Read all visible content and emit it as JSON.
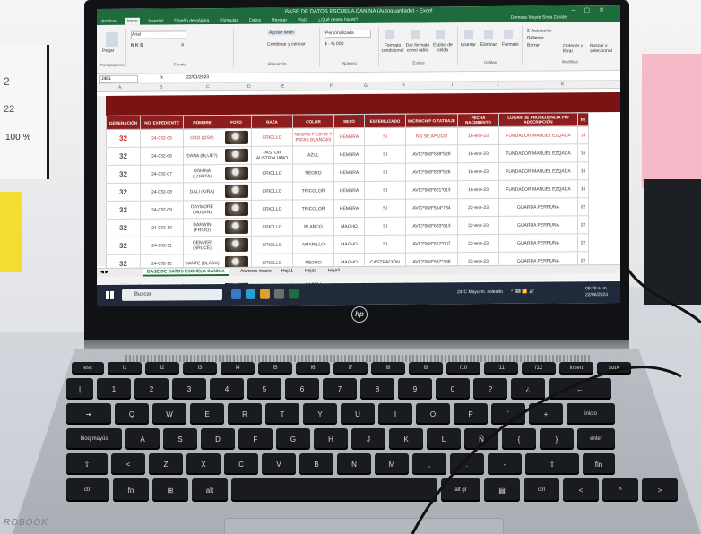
{
  "window": {
    "title": "BASE DE DATOS ESCUELA CANINA (Autoguardado) - Excel",
    "user": "Demaris Mayte Sosa Zarate",
    "share": "Compartir",
    "tabs": [
      "Archivo",
      "Inicio",
      "Insertar",
      "Diseño de página",
      "Fórmulas",
      "Datos",
      "Revisar",
      "Vista",
      "¿Qué desea hacer?"
    ]
  },
  "ribbon": {
    "paste": "Pegar",
    "clipboard": "Portapapeles",
    "font_name": "Arial",
    "font_group": "Fuente",
    "wrap": "Ajustar texto",
    "merge": "Combinar y centrar",
    "alignment_group": "Alineación",
    "number_format": "Personalizada",
    "number_group": "Número",
    "conditional": "Formato condicional",
    "as_table": "Dar formato como tabla",
    "cell_styles": "Estilos de celda",
    "styles_group": "Estilos",
    "insert": "Insertar",
    "delete": "Eliminar",
    "format": "Formato",
    "cells_group": "Celdas",
    "autosum": "Autosuma",
    "fill": "Rellenar",
    "clear": "Borrar",
    "sort": "Ordenar y filtrar",
    "find": "Buscar y seleccionar",
    "edit_group": "Modificar"
  },
  "formula_bar": {
    "ref": "J481",
    "fx": "fx",
    "value": "22/01/2023"
  },
  "columns": [
    "A",
    "B",
    "C",
    "D",
    "E",
    "F",
    "G",
    "H",
    "I",
    "J",
    "K"
  ],
  "table": {
    "headers": [
      "GENERACIÓN",
      "NO. EXPEDIENTE",
      "NOMBRE",
      "FOTO",
      "RAZA",
      "COLOR",
      "SEXO",
      "ESTERILIZADO",
      "MICROCHIP O TATUAJE",
      "FECHA NACIMIENTO",
      "LUGAR DE PROCEDENCIA PIO ADSCRIPCIÓN",
      "FE"
    ],
    "rows": [
      [
        "32",
        "24-032-05",
        "OSO (OSA)",
        "",
        "CRIOLLO",
        "NEGRO PECHO Y PATAS BLANCAS",
        "HEMBRA",
        "SI",
        "NO SE APLICO",
        "16-ene-23",
        "FUNDADOR MANUEL EZQADA",
        "15"
      ],
      [
        "32",
        "24-032-06",
        "DANA (BLUE?)",
        "",
        "PASTOR AUSTRALIANO",
        "AZUL",
        "HEMBRA",
        "SI",
        "AVID*068*538*529",
        "16-ene-23",
        "FUNDADOR MANUEL EZQADA",
        "16"
      ],
      [
        "32",
        "24-032-07",
        "OSHINA (LORITA)",
        "",
        "CRIOLLO",
        "NEGRO",
        "HEMBRA",
        "SI",
        "AVID*068*828*526",
        "16-ene-23",
        "FUNDADOR MANUEL EZQADA",
        "16"
      ],
      [
        "32",
        "24-032-08",
        "DALI (KIRA)",
        "",
        "CRIOLLO",
        "TRICOLOR",
        "HEMBRA",
        "SI",
        "AVID*068*621*013",
        "16-ene-23",
        "FUNDADOR MANUEL EZQADA",
        "16"
      ],
      [
        "32",
        "24-032-09",
        "DAYMORE (MULAN)",
        "",
        "CRIOLLO",
        "TRICOLOR",
        "HEMBRA",
        "SI",
        "AVID*068*514*784",
        "22-ene-23",
        "GUARDA PERRUNA",
        "22"
      ],
      [
        "32",
        "24-032-10",
        "DARWIN (FRIDO)",
        "",
        "CRIOLLO",
        "BLANCO",
        "MACHO",
        "SI",
        "AVID*068*620*613",
        "22-ene-23",
        "GUARDA PERRUNA",
        "22"
      ],
      [
        "32",
        "24-032-11",
        "DENVER (BRUCE)",
        "",
        "CRIOLLO",
        "AMARILLO",
        "MACHO",
        "SI",
        "AVID*068*522*007",
        "22-ene-23",
        "GUARDA PERRUNA",
        "22"
      ],
      [
        "32",
        "24-032-12",
        "DANTE (BLACK)",
        "",
        "CRIOLLO",
        "NEGRO",
        "MACHO",
        "CASTRACIÓN",
        "AVID*068*537*388",
        "22-ene-23",
        "GUARDA PERRUNA",
        "22"
      ],
      [
        "32",
        "24-032-13",
        "TONI",
        "",
        "CRIOLLO",
        "AMARILLO CLARO",
        "HEMBRA",
        "",
        "",
        "22-ene-23",
        "GUARDA PERRUNA",
        ""
      ]
    ]
  },
  "sheet_tabs": [
    "BASE DE DATOS ESCUELA CANINA",
    "Alumnos macro",
    "Hoja1",
    "Hoja2",
    "Hoja3"
  ],
  "taskbar": {
    "search": "Buscar",
    "weather": "24°C  Mayorm. soleado",
    "time": "09:38 a. m.",
    "date": "22/06/2024"
  },
  "laptop": {
    "logo": "hp",
    "brand": "ROBOOK"
  },
  "keys": {
    "row1": [
      "esc",
      "f1",
      "f2",
      "f3",
      "f4",
      "f5",
      "f6",
      "f7",
      "f8",
      "f9",
      "f10",
      "f11",
      "f12",
      "insert",
      "supr"
    ],
    "row2": [
      "|",
      "1",
      "2",
      "3",
      "4",
      "5",
      "6",
      "7",
      "8",
      "9",
      "0",
      "?",
      "¿",
      "←"
    ],
    "row3": [
      "⇥",
      "Q",
      "W",
      "E",
      "R",
      "T",
      "Y",
      "U",
      "I",
      "O",
      "P",
      "´",
      "+",
      "inicio"
    ],
    "row4": [
      "bloq mayús",
      "A",
      "S",
      "D",
      "F",
      "G",
      "H",
      "J",
      "K",
      "L",
      "Ñ",
      "{",
      "}",
      "enter"
    ],
    "row5": [
      "⇧",
      "<",
      "Z",
      "X",
      "C",
      "V",
      "B",
      "N",
      "M",
      ",",
      ".",
      "-",
      "⇧",
      "fin"
    ],
    "row6": [
      "ctrl",
      "fn",
      "⊞",
      "alt",
      "",
      "alt gr",
      "▤",
      "ctrl",
      "<",
      "^",
      ">"
    ]
  }
}
